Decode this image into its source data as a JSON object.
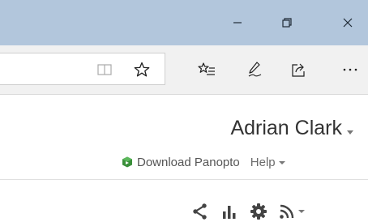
{
  "window": {
    "minimize_icon": "minimize-icon",
    "restore_icon": "restore-icon",
    "close_icon": "close-icon"
  },
  "toolbar": {
    "icons": [
      "reading-view-icon",
      "favorite-star-icon",
      "favorites-list-icon",
      "pen-icon",
      "share-icon",
      "more-icon"
    ]
  },
  "user": {
    "name": "Adrian Clark"
  },
  "links": {
    "download": "Download Panopto",
    "help": "Help"
  },
  "actions": {
    "icons": [
      "share-icon",
      "stats-icon",
      "settings-icon",
      "rss-icon"
    ]
  },
  "colors": {
    "titlebar": "#b2c6dc",
    "toolbar": "#f1f1f1",
    "panopto_green": "#3a8f3a"
  }
}
